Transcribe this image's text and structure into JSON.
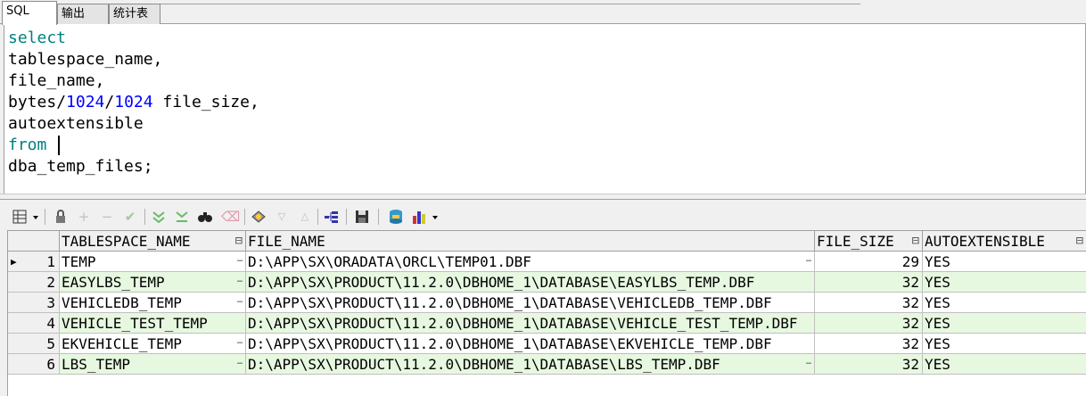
{
  "tabs": [
    {
      "label": "SQL",
      "active": true
    },
    {
      "label": "输出",
      "active": false
    },
    {
      "label": "统计表",
      "active": false
    }
  ],
  "editor": {
    "lines": [
      {
        "kw": "select"
      },
      {
        "text": "tablespace_name,"
      },
      {
        "text": "file_name,"
      },
      {
        "a": "bytes",
        "b": "/",
        "n1": "1024",
        "c": "/",
        "n2": "1024",
        "d": " file_size,"
      },
      {
        "text": "autoextensible"
      },
      {
        "kw": "from"
      },
      {
        "text": "dba_temp_files;"
      }
    ]
  },
  "toolbar": {
    "icons": [
      "grid-menu-icon",
      "lock-icon",
      "add-record-icon",
      "delete-record-icon",
      "post-edit-icon",
      "sort-asc-icon",
      "sort-desc-icon",
      "find-icon",
      "clear-icon",
      "query-icon",
      "filter-down-icon",
      "filter-up-icon",
      "explain-icon",
      "save-icon",
      "export-icon",
      "chart-icon"
    ]
  },
  "grid": {
    "columns": [
      "TABLESPACE_NAME",
      "FILE_NAME",
      "FILE_SIZE",
      "AUTOEXTENSIBLE"
    ],
    "rows": [
      {
        "n": "1",
        "ts": "TEMP",
        "file": "D:\\APP\\SX\\ORADATA\\ORCL\\TEMP01.DBF",
        "size": "29",
        "auto": "YES"
      },
      {
        "n": "2",
        "ts": "EASYLBS_TEMP",
        "file": "D:\\APP\\SX\\PRODUCT\\11.2.0\\DBHOME_1\\DATABASE\\EASYLBS_TEMP.DBF",
        "size": "32",
        "auto": "YES"
      },
      {
        "n": "3",
        "ts": "VEHICLEDB_TEMP",
        "file": "D:\\APP\\SX\\PRODUCT\\11.2.0\\DBHOME_1\\DATABASE\\VEHICLEDB_TEMP.DBF",
        "size": "32",
        "auto": "YES"
      },
      {
        "n": "4",
        "ts": "VEHICLE_TEST_TEMP",
        "file": "D:\\APP\\SX\\PRODUCT\\11.2.0\\DBHOME_1\\DATABASE\\VEHICLE_TEST_TEMP.DBF",
        "size": "32",
        "auto": "YES"
      },
      {
        "n": "5",
        "ts": "EKVEHICLE_TEMP",
        "file": "D:\\APP\\SX\\PRODUCT\\11.2.0\\DBHOME_1\\DATABASE\\EKVEHICLE_TEMP.DBF",
        "size": "32",
        "auto": "YES"
      },
      {
        "n": "6",
        "ts": "LBS_TEMP",
        "file": "D:\\APP\\SX\\PRODUCT\\11.2.0\\DBHOME_1\\DATABASE\\LBS_TEMP.DBF",
        "size": "32",
        "auto": "YES"
      }
    ]
  }
}
